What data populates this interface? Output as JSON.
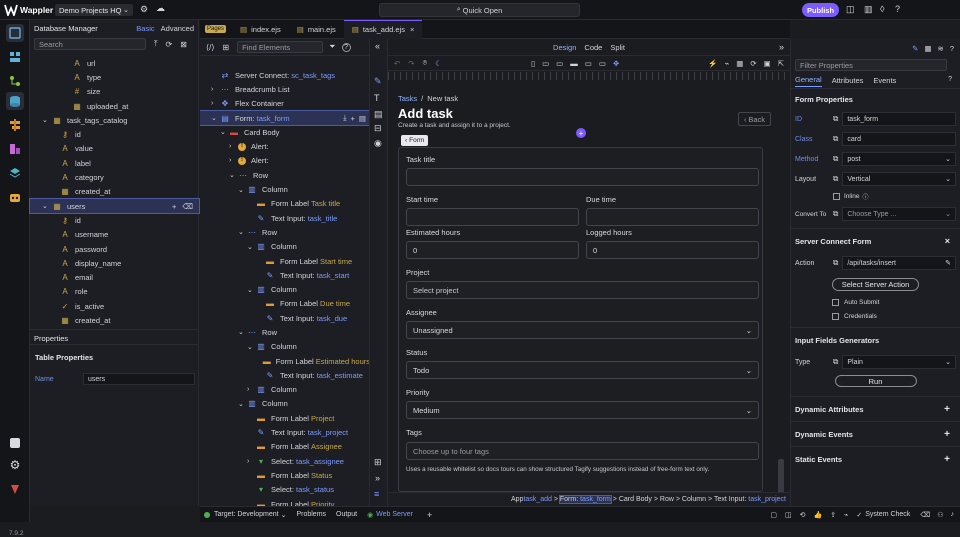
{
  "app": {
    "name": "Wappler",
    "project": "Demo Projects HQ",
    "quick_open": "Quick Open",
    "publish": "Publish",
    "version": "7.9.2"
  },
  "db": {
    "title": "Database Manager",
    "mode_basic": "Basic",
    "mode_advanced": "Advanced",
    "search_placeholder": "Search",
    "items": [
      {
        "label": "url",
        "kind": "text",
        "depth": 3
      },
      {
        "label": "type",
        "kind": "text",
        "depth": 3
      },
      {
        "label": "size",
        "kind": "num",
        "depth": 3
      },
      {
        "label": "uploaded_at",
        "kind": "date",
        "depth": 3
      },
      {
        "label": "task_tags_catalog",
        "kind": "table",
        "depth": 1,
        "expand": "⌄"
      },
      {
        "label": "id",
        "kind": "key",
        "depth": 2
      },
      {
        "label": "value",
        "kind": "text",
        "depth": 2
      },
      {
        "label": "label",
        "kind": "text",
        "depth": 2
      },
      {
        "label": "category",
        "kind": "text",
        "depth": 2
      },
      {
        "label": "created_at",
        "kind": "date",
        "depth": 2
      },
      {
        "label": "users",
        "kind": "table",
        "depth": 1,
        "expand": "⌄",
        "selected": true
      },
      {
        "label": "id",
        "kind": "key",
        "depth": 2
      },
      {
        "label": "username",
        "kind": "text",
        "depth": 2
      },
      {
        "label": "password",
        "kind": "text",
        "depth": 2
      },
      {
        "label": "display_name",
        "kind": "text",
        "depth": 2
      },
      {
        "label": "email",
        "kind": "text",
        "depth": 2
      },
      {
        "label": "role",
        "kind": "text",
        "depth": 2
      },
      {
        "label": "is_active",
        "kind": "check",
        "depth": 2
      },
      {
        "label": "created_at",
        "kind": "date",
        "depth": 2
      }
    ],
    "properties_title": "Properties",
    "table_properties": "Table Properties",
    "name_label": "Name",
    "name_value": "users"
  },
  "tabs": {
    "pages_badge": "Pages",
    "items": [
      {
        "label": "index.ejs"
      },
      {
        "label": "main.ejs"
      },
      {
        "label": "task_add.ejs",
        "active": true
      }
    ],
    "close": "×"
  },
  "tree": {
    "find_placeholder": "Find Elements",
    "items": [
      {
        "depth": 1,
        "caret": "",
        "icon": "sc",
        "label": "Server Connect: ",
        "hl": "sc_task_tags"
      },
      {
        "depth": 1,
        "caret": "›",
        "icon": "bc",
        "label": "Breadcrumb List",
        "hl": ""
      },
      {
        "depth": 1,
        "caret": "›",
        "icon": "flex",
        "label": "Flex Container",
        "hl": ""
      },
      {
        "depth": 1,
        "caret": "⌄",
        "icon": "form",
        "label": "Form: ",
        "hl": "task_form",
        "selected": true
      },
      {
        "depth": 2,
        "caret": "⌄",
        "icon": "card",
        "label": "Card Body",
        "hl": ""
      },
      {
        "depth": 3,
        "caret": "›",
        "icon": "alert",
        "label": "Alert:",
        "hl": ""
      },
      {
        "depth": 3,
        "caret": "›",
        "icon": "alert",
        "label": "Alert:",
        "hl": ""
      },
      {
        "depth": 3,
        "caret": "⌄",
        "icon": "row",
        "label": "Row",
        "hl": ""
      },
      {
        "depth": 4,
        "caret": "⌄",
        "icon": "col",
        "label": "Column",
        "hl": ""
      },
      {
        "depth": 5,
        "caret": "",
        "icon": "flabel",
        "label": "Form Label ",
        "hl": "Task title"
      },
      {
        "depth": 5,
        "caret": "",
        "icon": "input",
        "label": "Text Input: ",
        "hl": "task_title"
      },
      {
        "depth": 4,
        "caret": "⌄",
        "icon": "row",
        "label": "Row",
        "hl": ""
      },
      {
        "depth": 5,
        "caret": "⌄",
        "icon": "col",
        "label": "Column",
        "hl": ""
      },
      {
        "depth": 6,
        "caret": "",
        "icon": "flabel",
        "label": "Form Label ",
        "hl": "Start time"
      },
      {
        "depth": 6,
        "caret": "",
        "icon": "input",
        "label": "Text Input: ",
        "hl": "task_start"
      },
      {
        "depth": 5,
        "caret": "⌄",
        "icon": "col",
        "label": "Column",
        "hl": ""
      },
      {
        "depth": 6,
        "caret": "",
        "icon": "flabel",
        "label": "Form Label ",
        "hl": "Due time"
      },
      {
        "depth": 6,
        "caret": "",
        "icon": "input",
        "label": "Text Input: ",
        "hl": "task_due"
      },
      {
        "depth": 4,
        "caret": "⌄",
        "icon": "row",
        "label": "Row",
        "hl": ""
      },
      {
        "depth": 5,
        "caret": "⌄",
        "icon": "col",
        "label": "Column",
        "hl": ""
      },
      {
        "depth": 6,
        "caret": "",
        "icon": "flabel",
        "label": "Form Label ",
        "hl": "Estimated hours"
      },
      {
        "depth": 6,
        "caret": "",
        "icon": "input",
        "label": "Text Input: ",
        "hl": "task_estimate"
      },
      {
        "depth": 5,
        "caret": "›",
        "icon": "col",
        "label": "Column",
        "hl": ""
      },
      {
        "depth": 4,
        "caret": "⌄",
        "icon": "col",
        "label": "Column",
        "hl": ""
      },
      {
        "depth": 5,
        "caret": "",
        "icon": "flabel",
        "label": "Form Label ",
        "hl": "Project"
      },
      {
        "depth": 5,
        "caret": "",
        "icon": "input",
        "label": "Text Input: ",
        "hl": "task_project"
      },
      {
        "depth": 5,
        "caret": "",
        "icon": "flabel",
        "label": "Form Label ",
        "hl": "Assignee"
      },
      {
        "depth": 5,
        "caret": "›",
        "icon": "select",
        "label": "Select: ",
        "hl": "task_assignee"
      },
      {
        "depth": 5,
        "caret": "",
        "icon": "flabel",
        "label": "Form Label ",
        "hl": "Status"
      },
      {
        "depth": 5,
        "caret": "",
        "icon": "select",
        "label": "Select: ",
        "hl": "task_status"
      },
      {
        "depth": 5,
        "caret": "",
        "icon": "flabel",
        "label": "Form Label ",
        "hl": "Priority"
      }
    ]
  },
  "design": {
    "modes": [
      "Design",
      "Code",
      "Split"
    ],
    "breadcrumb": [
      "Tasks",
      "New task"
    ],
    "heading": "Add task",
    "subheading": "Create a task and assign it to a project.",
    "back": "Back",
    "form_badge": "Form",
    "fields": {
      "task_title": "Task title",
      "start_time": "Start time",
      "due_time": "Due time",
      "estimated_hours": "Estimated hours",
      "estimated_value": "0",
      "logged_hours": "Logged hours",
      "logged_value": "0",
      "project": "Project",
      "project_placeholder": "Select project",
      "assignee": "Assignee",
      "assignee_value": "Unassigned",
      "status": "Status",
      "status_value": "Todo",
      "priority": "Priority",
      "priority_value": "Medium",
      "tags": "Tags",
      "tags_placeholder": "Choose up to four tags",
      "tags_help": "Uses a reusable whitelist so docs tours can show structured Tagify suggestions instead of free-form text only."
    }
  },
  "props": {
    "filter_placeholder": "Filter Properties",
    "tabs": [
      "General",
      "Attributes",
      "Events"
    ],
    "form_properties": "Form Properties",
    "id_label": "ID",
    "id_value": "task_form",
    "class_label": "Class",
    "class_value": "card",
    "method_label": "Method",
    "method_value": "post",
    "layout_label": "Layout",
    "layout_value": "Vertical",
    "inline_label": "Inline",
    "convert_label": "Convert To",
    "convert_placeholder": "Choose Type ...",
    "sc_form": "Server Connect Form",
    "action_label": "Action",
    "action_value": "/api/tasks/insert",
    "select_action": "Select Server Action",
    "auto_submit": "Auto Submit",
    "credentials": "Credentials",
    "generators": "Input Fields Generators",
    "type_label": "Type",
    "type_value": "Plain",
    "run": "Run",
    "sections": [
      "Dynamic Attributes",
      "Dynamic Events",
      "Static Events"
    ]
  },
  "statusbar": {
    "target": "Target: Development",
    "problems": "Problems",
    "output": "Output",
    "web_server": "Web Server",
    "system_check": "System Check",
    "path_prefix": "App ",
    "path": [
      {
        "label": "",
        "hl": "task_add"
      },
      {
        "label": "Form: ",
        "hl": "task_form",
        "active": true
      },
      {
        "label": "Card Body",
        "hl": ""
      },
      {
        "label": "Row",
        "hl": ""
      },
      {
        "label": "Column",
        "hl": ""
      },
      {
        "label": "Text Input: ",
        "hl": "task_project"
      }
    ]
  },
  "colors": {
    "accent": "#7c5cff",
    "highlight": "#c7a94e",
    "teal": "#4aa3c9"
  }
}
